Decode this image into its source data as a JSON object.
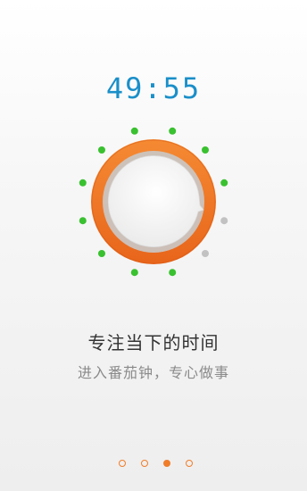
{
  "timer": {
    "display": "49:55"
  },
  "dial": {
    "ticks_total": 12,
    "ticks_remaining": 10,
    "active_color": "#39c12f",
    "inactive_color": "#c2c2c2",
    "ring_color": "#f07d2a",
    "face_color": "#f4f4f4"
  },
  "onboarding": {
    "title": "专注当下的时间",
    "subtitle": "进入番茄钟，专心做事"
  },
  "pager": {
    "total_pages": 4,
    "current_page": 3,
    "color": "#f07d2a"
  }
}
